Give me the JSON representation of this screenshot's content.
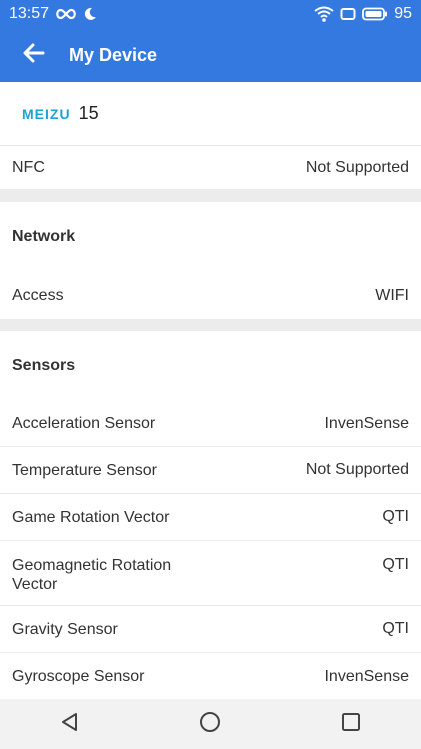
{
  "status_bar": {
    "time": "13:57",
    "battery": "95",
    "icons": [
      "infinity-icon",
      "moon-icon",
      "wifi-icon",
      "screen-icon",
      "battery-icon"
    ]
  },
  "header": {
    "title": "My Device",
    "back_icon": "back-arrow-icon"
  },
  "device": {
    "brand": "MEIZU",
    "model": "15"
  },
  "rows_top": [
    {
      "label": "NFC",
      "value": "Not Supported"
    }
  ],
  "network": {
    "title": "Network",
    "rows": [
      {
        "label": "Access",
        "value": "WIFI"
      }
    ]
  },
  "sensors": {
    "title": "Sensors",
    "rows": [
      {
        "label": "Acceleration Sensor",
        "value": "InvenSense"
      },
      {
        "label": "Temperature Sensor",
        "value": "Not Supported"
      },
      {
        "label": "Game Rotation Vector",
        "value": "QTI"
      },
      {
        "label": "Geomagnetic Rotation Vector",
        "value": "QTI"
      },
      {
        "label": "Gravity Sensor",
        "value": "QTI"
      },
      {
        "label": "Gyroscope Sensor",
        "value": "InvenSense"
      }
    ]
  },
  "nav_bar": {
    "icons": [
      "back-triangle-icon",
      "home-circle-icon",
      "recents-square-icon"
    ]
  },
  "colors": {
    "accent": "#3479e0",
    "brand": "#1aa3d9"
  }
}
